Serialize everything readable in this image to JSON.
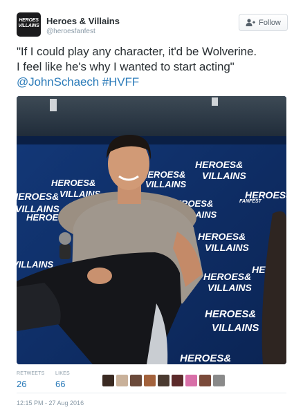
{
  "header": {
    "avatar_line1": "HEROES",
    "avatar_line2": "VILLAINS",
    "display_name": "Heroes & Villains",
    "handle": "@heroesfanfest",
    "follow_label": "Follow"
  },
  "tweet": {
    "line1": "\"If I could play any character, it'd be Wolverine.",
    "line2": "I feel like he's why I wanted to start acting\"",
    "mention": "@JohnSchaech",
    "hashtag": "#HVFF"
  },
  "photo": {
    "backdrop_logo_line1": "HEROES&",
    "backdrop_logo_line2": "VILLAINS",
    "backdrop_logo_tag": "FANFEST"
  },
  "stats": {
    "retweets_label": "RETWEETS",
    "retweets_value": "26",
    "likes_label": "LIKES",
    "likes_value": "66"
  },
  "likers": [
    "#3a2a22",
    "#c9b19a",
    "#6b4a3a",
    "#a3623c",
    "#4a3a30",
    "#5b2a2a",
    "#d870a8",
    "#7a4a3a",
    "#8a8a8a"
  ],
  "timestamp": "12:15 PM - 27 Aug 2016",
  "colors": {
    "link": "#2b7bb9",
    "muted": "#8899a6",
    "backdrop": "#0e2a5c"
  }
}
